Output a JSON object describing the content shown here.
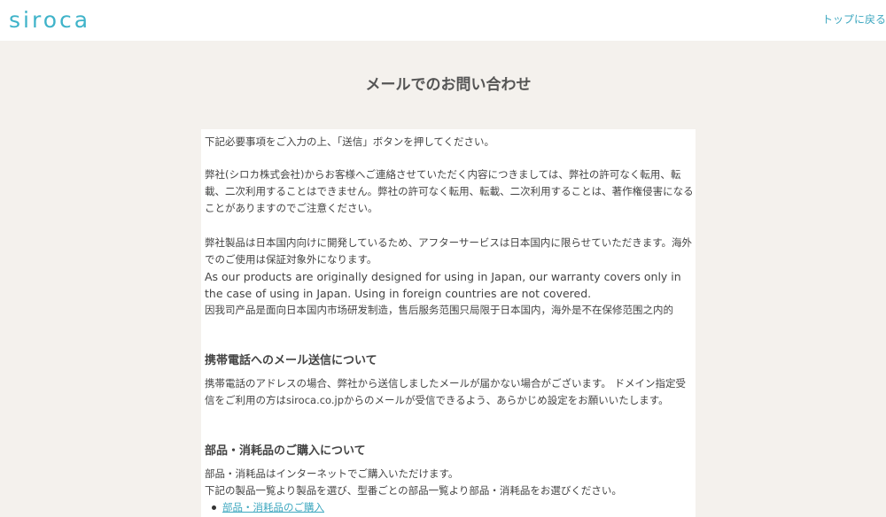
{
  "header": {
    "logo_text": "siroca",
    "top_link": "トップに戻る"
  },
  "page": {
    "title": "メールでのお問い合わせ"
  },
  "content": {
    "intro": "下記必要事項をご入力の上、「送信」ボタンを押してください。",
    "copyright_notice": "弊社(シロカ株式会社)からお客様へご連絡させていただく内容につきましては、弊社の許可なく転用、転載、二次利用することはできません。弊社の許可なく転用、転載、二次利用することは、著作権侵害になることがありますのでご注意ください。",
    "overseas_ja": "弊社製品は日本国内向けに開発しているため、アフターサービスは日本国内に限らせていただきます。海外でのご使用は保証対象外になります。",
    "overseas_en": "As our products are originally designed for using in Japan, our warranty covers only in the case of using in Japan. Using in foreign countries are not covered.",
    "overseas_zh": "因我司产品是面向日本国内市场研发制造，售后服务范围只局限于日本国内，海外是不在保修范围之内的",
    "mobile_heading": "携帯電話へのメール送信について",
    "mobile_text": "携帯電話のアドレスの場合、弊社から送信しましたメールが届かない場合がございます。 ドメイン指定受信をご利用の方はsiroca.co.jpからのメールが受信できるよう、あらかじめ設定をお願いいたします。",
    "parts_heading": "部品・消耗品のご購入について",
    "parts_text_1": "部品・消耗品はインターネットでご購入いただけます。",
    "parts_text_2": "下記の製品一覧より製品を選び、型番ごとの部品一覧より部品・消耗品をお選びください。",
    "parts_link": "部品・消耗品のご購入"
  }
}
